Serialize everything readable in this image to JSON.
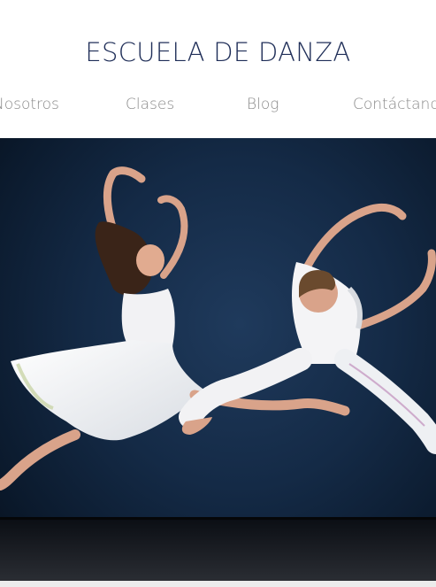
{
  "site": {
    "title": "ESCUELA DE DANZA"
  },
  "nav": {
    "items": [
      {
        "label": "Nosotros"
      },
      {
        "label": "Clases"
      },
      {
        "label": "Blog"
      },
      {
        "label": "Contáctanos"
      }
    ]
  },
  "hero": {
    "image_alt": "Two dancers in white leaping on a dark blue stage"
  },
  "colors": {
    "title": "#1f2e58",
    "nav_text": "#8a8a8a",
    "stage_bg": "#142a46"
  }
}
